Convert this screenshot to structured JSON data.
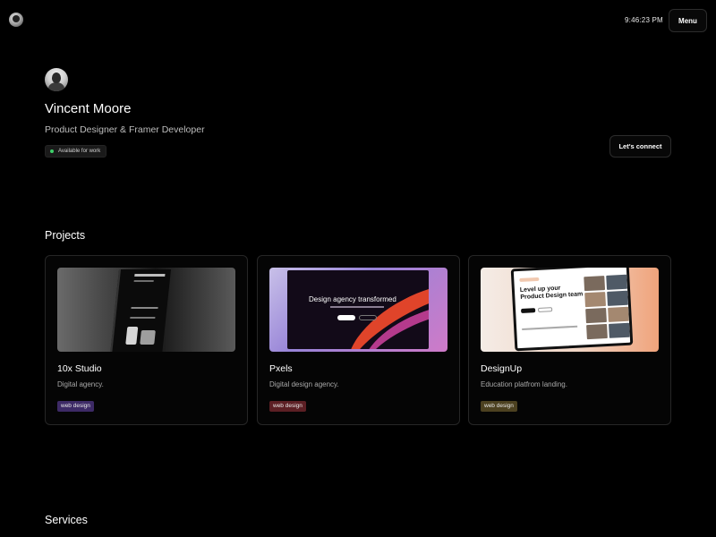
{
  "header": {
    "clock": "9:46:23 PM",
    "menu_label": "Menu",
    "avatar_icon": "avatar-icon"
  },
  "hero": {
    "name": "Vincent Moore",
    "role": "Product Designer & Framer Developer",
    "status": "Available for work",
    "status_color": "#3ecf6a",
    "connect_label": "Let's connect"
  },
  "projects": {
    "title": "Projects",
    "items": [
      {
        "title": "10x Studio",
        "description": "Digital agency.",
        "tag": "web design",
        "tag_color": "#3d2a66"
      },
      {
        "title": "Pxels",
        "description": "Digital design agency.",
        "tag": "web design",
        "tag_color": "#5c1f24",
        "thumb_headline": "Design agency transformed"
      },
      {
        "title": "DesignUp",
        "description": "Education platfrom landing.",
        "tag": "web design",
        "tag_color": "#4c4120",
        "thumb_headline": "Level up your Product Design team"
      }
    ]
  },
  "services": {
    "title": "Services"
  }
}
